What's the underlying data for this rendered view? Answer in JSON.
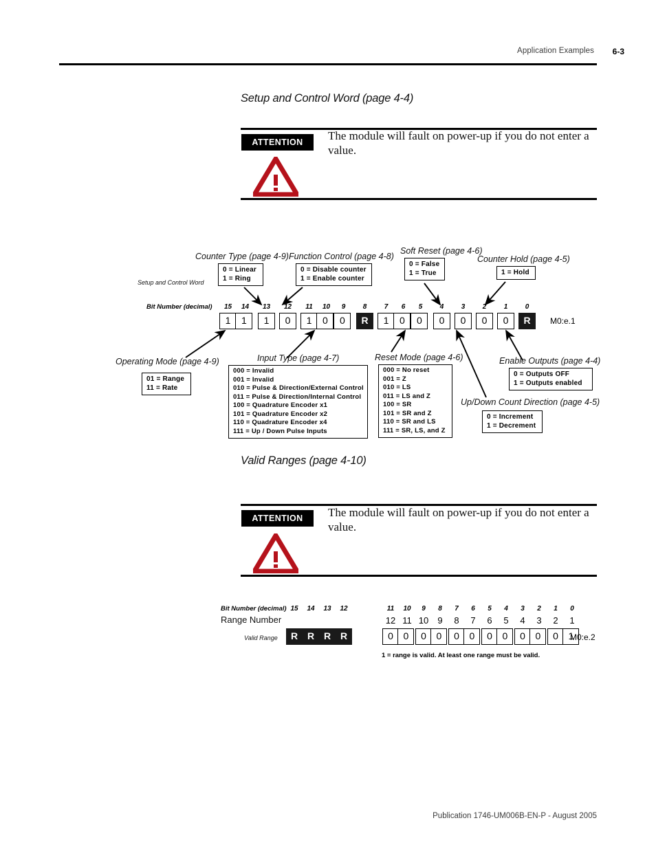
{
  "header": {
    "chapter_title": "Application Examples",
    "page_number": "6-3"
  },
  "footer": {
    "publication": "Publication 1746-UM006B-EN-P - August 2005"
  },
  "sections": [
    {
      "title": "Setup and Control Word (page 4-4)"
    },
    {
      "title": "Valid Ranges (page 4-10)"
    }
  ],
  "attention": {
    "badge": "ATTENTION",
    "text": "The module will fault on power-up if you do not enter a value.",
    "icon": "warning-triangle-icon",
    "icon_color": "#b5121b"
  },
  "setup_word": {
    "row_label": "Setup and Control Word",
    "bit_number_label": "Bit Number (decimal)",
    "word_reference": "M0:e.1",
    "bits": [
      {
        "bit": "15",
        "value": "1",
        "reserved": false,
        "group": 0
      },
      {
        "bit": "14",
        "value": "1",
        "reserved": false,
        "group": 0
      },
      {
        "bit": "13",
        "value": "1",
        "reserved": false,
        "group": 1
      },
      {
        "bit": "12",
        "value": "0",
        "reserved": false,
        "group": 2
      },
      {
        "bit": "11",
        "value": "1",
        "reserved": false,
        "group": 3
      },
      {
        "bit": "10",
        "value": "0",
        "reserved": false,
        "group": 3
      },
      {
        "bit": "9",
        "value": "0",
        "reserved": false,
        "group": 3
      },
      {
        "bit": "8",
        "value": "R",
        "reserved": true,
        "group": 4
      },
      {
        "bit": "7",
        "value": "1",
        "reserved": false,
        "group": 5
      },
      {
        "bit": "6",
        "value": "0",
        "reserved": false,
        "group": 5
      },
      {
        "bit": "5",
        "value": "0",
        "reserved": false,
        "group": 5
      },
      {
        "bit": "4",
        "value": "0",
        "reserved": false,
        "group": 6
      },
      {
        "bit": "3",
        "value": "0",
        "reserved": false,
        "group": 7
      },
      {
        "bit": "2",
        "value": "0",
        "reserved": false,
        "group": 8
      },
      {
        "bit": "1",
        "value": "0",
        "reserved": false,
        "group": 9
      },
      {
        "bit": "0",
        "value": "R",
        "reserved": true,
        "group": 10
      }
    ],
    "callouts": {
      "counter_type": {
        "title": "Counter Type (page 4-9)",
        "lines": [
          "0 = Linear",
          "1 = Ring"
        ]
      },
      "function_control": {
        "title": "Function Control (page 4-8)",
        "lines": [
          "0 = Disable counter",
          "1 = Enable counter"
        ]
      },
      "soft_reset": {
        "title": "Soft Reset (page 4-6)",
        "lines": [
          "0 = False",
          "1 = True"
        ]
      },
      "counter_hold": {
        "title": "Counter Hold (page 4-5)",
        "lines": [
          "1 = Hold"
        ]
      },
      "operating_mode": {
        "title": "Operating Mode (page 4-9)",
        "lines": [
          "01 = Range",
          "11 = Rate"
        ]
      },
      "input_type": {
        "title": "Input Type (page 4-7)",
        "lines": [
          "000 = Invalid",
          "001 = Invalid",
          "010 = Pulse & Direction/External Control",
          "011 = Pulse & Direction/Internal Control",
          "100 = Quadrature Encoder x1",
          "101 = Quadrature Encoder x2",
          "110 = Quadrature Encoder x4",
          "111 = Up / Down Pulse Inputs"
        ]
      },
      "reset_mode": {
        "title": "Reset Mode (page 4-6)",
        "lines": [
          "000 = No reset",
          "001 = Z",
          "010 = LS",
          "011 = LS and Z",
          "100 = SR",
          "101 = SR and Z",
          "110 = SR and LS",
          "111 = SR, LS, and Z"
        ]
      },
      "enable_outputs": {
        "title": "Enable Outputs (page 4-4)",
        "lines": [
          "0 = Outputs OFF",
          "1 = Outputs enabled"
        ]
      },
      "count_direction": {
        "title": "Up/Down Count Direction (page 4-5)",
        "lines": [
          "0 = Increment",
          "1 = Decrement"
        ]
      }
    }
  },
  "valid_ranges": {
    "bit_number_label": "Bit Number (decimal)",
    "range_number_label": "Range Number",
    "valid_range_label": "Valid Range",
    "word_reference": "M0:e.2",
    "note": "1 =  range is valid.  At least one range must be valid.",
    "reserved_bits": [
      "15",
      "14",
      "13",
      "12"
    ],
    "reserved_values": [
      "R",
      "R",
      "R",
      "R"
    ],
    "data_bits": [
      "11",
      "10",
      "9",
      "8",
      "7",
      "6",
      "5",
      "4",
      "3",
      "2",
      "1",
      "0"
    ],
    "range_numbers": [
      "12",
      "11",
      "10",
      "9",
      "8",
      "7",
      "6",
      "5",
      "4",
      "3",
      "2",
      "1"
    ],
    "data_values": [
      "0",
      "0",
      "0",
      "0",
      "0",
      "0",
      "0",
      "0",
      "0",
      "0",
      "0",
      "1"
    ]
  }
}
